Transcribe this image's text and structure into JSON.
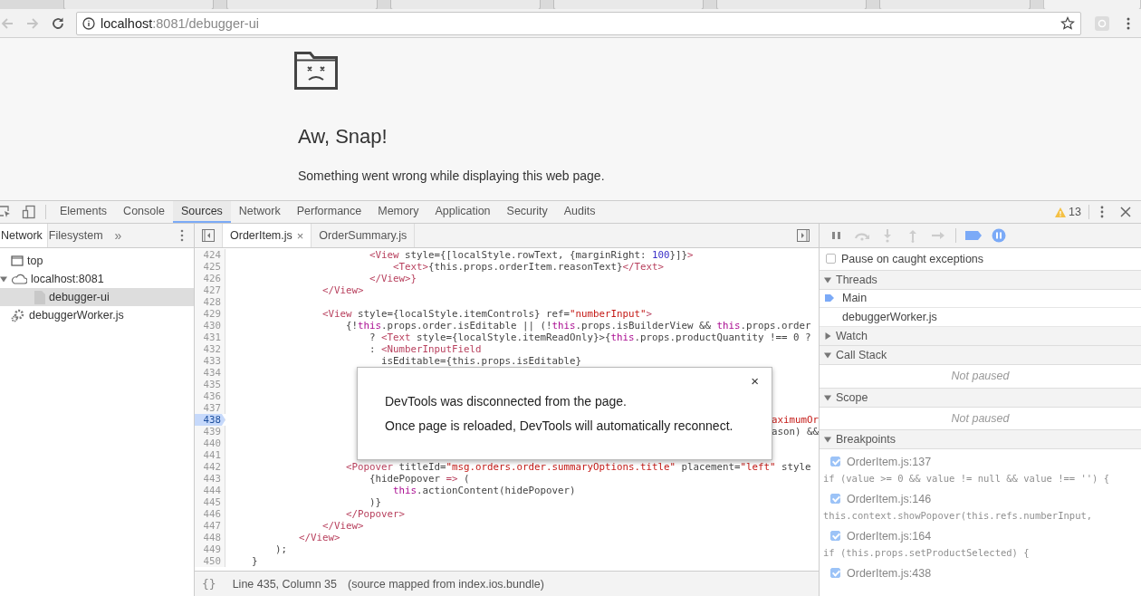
{
  "browser": {
    "tabs": [
      {
        "selected": false
      },
      {
        "selected": false
      },
      {
        "selected": false
      },
      {
        "selected": false
      },
      {
        "selected": false
      },
      {
        "selected": false
      },
      {
        "selected": true
      }
    ],
    "url": {
      "host": "localhost",
      "rest": ":8081/debugger-ui"
    }
  },
  "crash_page": {
    "title": "Aw, Snap!",
    "message": "Something went wrong while displaying this web page."
  },
  "devtools": {
    "tabs": [
      {
        "label": "Elements",
        "selected": false
      },
      {
        "label": "Console",
        "selected": false
      },
      {
        "label": "Sources",
        "selected": true
      },
      {
        "label": "Network",
        "selected": false
      },
      {
        "label": "Performance",
        "selected": false
      },
      {
        "label": "Memory",
        "selected": false
      },
      {
        "label": "Application",
        "selected": false
      },
      {
        "label": "Security",
        "selected": false
      },
      {
        "label": "Audits",
        "selected": false
      }
    ],
    "warning_count": "13",
    "navigator": {
      "tabs": [
        {
          "label": "Network",
          "selected": true
        },
        {
          "label": "Filesystem",
          "selected": false
        }
      ],
      "more": "»",
      "tree": [
        {
          "label": "top",
          "kind": "frame",
          "selected": false
        },
        {
          "label": "localhost:8081",
          "kind": "domain",
          "expanded": true,
          "selected": false,
          "children": [
            {
              "label": "debugger-ui",
              "kind": "file",
              "selected": true
            }
          ]
        },
        {
          "label": "debuggerWorker.js",
          "kind": "worker",
          "selected": false
        }
      ]
    },
    "editor": {
      "tabs": [
        {
          "label": "OrderItem.js",
          "selected": true,
          "close": "×"
        },
        {
          "label": "OrderSummary.js",
          "selected": false
        }
      ],
      "lines": [
        {
          "n": "424",
          "breakpoint": false,
          "tokens": [
            {
              "kind": "tag",
              "text": "                        <View"
            },
            {
              "kind": "plain",
              "text": " style={[localStyle.rowText, {marginRight: "
            },
            {
              "kind": "num",
              "text": "100"
            },
            {
              "kind": "plain",
              "text": "}]}"
            },
            {
              "kind": "tag",
              "text": ">"
            }
          ]
        },
        {
          "n": "425",
          "breakpoint": false,
          "tokens": [
            {
              "kind": "tag",
              "text": "                            <Text>"
            },
            {
              "kind": "plain",
              "text": "{this.props.orderItem.reasonText}"
            },
            {
              "kind": "tag",
              "text": "</Text>"
            }
          ]
        },
        {
          "n": "426",
          "breakpoint": false,
          "tokens": [
            {
              "kind": "tag",
              "text": "                        </View>}"
            }
          ]
        },
        {
          "n": "427",
          "breakpoint": false,
          "tokens": [
            {
              "kind": "tag",
              "text": "                </View>"
            }
          ]
        },
        {
          "n": "428",
          "breakpoint": false
        },
        {
          "n": "429",
          "breakpoint": false,
          "tokens": [
            {
              "kind": "tag",
              "text": "                <View"
            },
            {
              "kind": "plain",
              "text": " style={localStyle.itemControls} ref="
            },
            {
              "kind": "str",
              "text": "\"numberInput\""
            },
            {
              "kind": "tag",
              "text": ">"
            }
          ]
        },
        {
          "n": "430",
          "breakpoint": false,
          "tokens": [
            {
              "kind": "plain",
              "text": "                    {!"
            },
            {
              "kind": "kw",
              "text": "this"
            },
            {
              "kind": "plain",
              "text": ".props.order.isEditable || (!"
            },
            {
              "kind": "kw",
              "text": "this"
            },
            {
              "kind": "plain",
              "text": ".props.isBuilderView && "
            },
            {
              "kind": "kw",
              "text": "this"
            },
            {
              "kind": "plain",
              "text": ".props.order"
            }
          ]
        },
        {
          "n": "431",
          "breakpoint": false,
          "tokens": [
            {
              "kind": "plain",
              "text": "                        ? "
            },
            {
              "kind": "tag",
              "text": "<Text"
            },
            {
              "kind": "plain",
              "text": " style={localStyle.itemReadOnly}>{"
            },
            {
              "kind": "kw",
              "text": "this"
            },
            {
              "kind": "plain",
              "text": ".props.productQuantity !== 0 ?"
            }
          ]
        },
        {
          "n": "432",
          "breakpoint": false,
          "tokens": [
            {
              "kind": "plain",
              "text": "                        : "
            },
            {
              "kind": "tag",
              "text": "<NumberInputField"
            }
          ]
        },
        {
          "n": "433",
          "breakpoint": false,
          "tokens": [
            {
              "kind": "plain",
              "text": "                          isEditable={this.props.isEditable}"
            }
          ]
        },
        {
          "n": "434",
          "breakpoint": false
        },
        {
          "n": "435",
          "breakpoint": false
        },
        {
          "n": "436",
          "breakpoint": false
        },
        {
          "n": "437",
          "breakpoint": false
        },
        {
          "n": "438",
          "breakpoint": true,
          "tail": [
            {
              "kind": "str",
              "text": "aximumOr"
            }
          ]
        },
        {
          "n": "439",
          "breakpoint": false,
          "tail": [
            {
              "kind": "plain",
              "text": "ason) &&"
            }
          ]
        },
        {
          "n": "440",
          "breakpoint": false
        },
        {
          "n": "441",
          "breakpoint": false
        },
        {
          "n": "442",
          "breakpoint": false,
          "tokens": [
            {
              "kind": "tag",
              "text": "                    <Popover"
            },
            {
              "kind": "plain",
              "text": " titleId="
            },
            {
              "kind": "str",
              "text": "\"msg.orders.order.summaryOptions.title\""
            },
            {
              "kind": "plain",
              "text": " placement="
            },
            {
              "kind": "str",
              "text": "\"left\""
            },
            {
              "kind": "plain",
              "text": " style"
            }
          ]
        },
        {
          "n": "443",
          "breakpoint": false,
          "tokens": [
            {
              "kind": "plain",
              "text": "                        {hidePopover "
            },
            {
              "kind": "tag",
              "text": "=>"
            },
            {
              "kind": "plain",
              "text": " ("
            }
          ]
        },
        {
          "n": "444",
          "breakpoint": false,
          "tokens": [
            {
              "kind": "kw",
              "text": "                            this"
            },
            {
              "kind": "plain",
              "text": ".actionContent(hidePopover)"
            }
          ]
        },
        {
          "n": "445",
          "breakpoint": false,
          "tokens": [
            {
              "kind": "plain",
              "text": "                        )}"
            }
          ]
        },
        {
          "n": "446",
          "breakpoint": false,
          "tokens": [
            {
              "kind": "tag",
              "text": "                    </Popover>"
            }
          ]
        },
        {
          "n": "447",
          "breakpoint": false,
          "tokens": [
            {
              "kind": "tag",
              "text": "                </View>"
            }
          ]
        },
        {
          "n": "448",
          "breakpoint": false,
          "tokens": [
            {
              "kind": "tag",
              "text": "            </View>"
            }
          ]
        },
        {
          "n": "449",
          "breakpoint": false,
          "tokens": [
            {
              "kind": "plain",
              "text": "        );"
            }
          ]
        },
        {
          "n": "450",
          "breakpoint": false,
          "tokens": [
            {
              "kind": "plain",
              "text": "    }"
            }
          ]
        }
      ],
      "status": {
        "format": "{}",
        "position": "Line 435, Column 35",
        "source_map": "(source mapped from index.ios.bundle)"
      }
    },
    "dialog": {
      "close": "×",
      "lines": [
        "DevTools was disconnected from the page.",
        "Once page is reloaded, DevTools will automatically reconnect."
      ]
    },
    "debugger": {
      "pause_on_caught": {
        "label": "Pause on caught exceptions",
        "checked": false
      },
      "sections": [
        {
          "title": "Threads",
          "expanded": true,
          "items": [
            {
              "kind": "thread",
              "label": "Main",
              "selected": true
            },
            {
              "kind": "thread",
              "label": "debuggerWorker.js",
              "selected": false
            }
          ]
        },
        {
          "title": "Watch",
          "expanded": false
        },
        {
          "title": "Call Stack",
          "expanded": true,
          "items": [
            {
              "kind": "note",
              "text": "Not paused"
            }
          ]
        },
        {
          "title": "Scope",
          "expanded": true,
          "items": [
            {
              "kind": "note",
              "text": "Not paused"
            }
          ]
        },
        {
          "title": "Breakpoints",
          "expanded": true,
          "items": [
            {
              "kind": "breakpoint",
              "label": "OrderItem.js:137",
              "code": "if (value >= 0 && value != null && value !== '') {",
              "checked": true,
              "disabled": true
            },
            {
              "kind": "breakpoint",
              "label": "OrderItem.js:146",
              "code": "this.context.showPopover(this.refs.numberInput,",
              "checked": true,
              "disabled": true
            },
            {
              "kind": "breakpoint",
              "label": "OrderItem.js:164",
              "code": "if (this.props.setProductSelected) {",
              "checked": true,
              "disabled": true
            },
            {
              "kind": "breakpoint",
              "label": "OrderItem.js:438",
              "checked": true,
              "disabled": true
            }
          ]
        }
      ]
    }
  }
}
